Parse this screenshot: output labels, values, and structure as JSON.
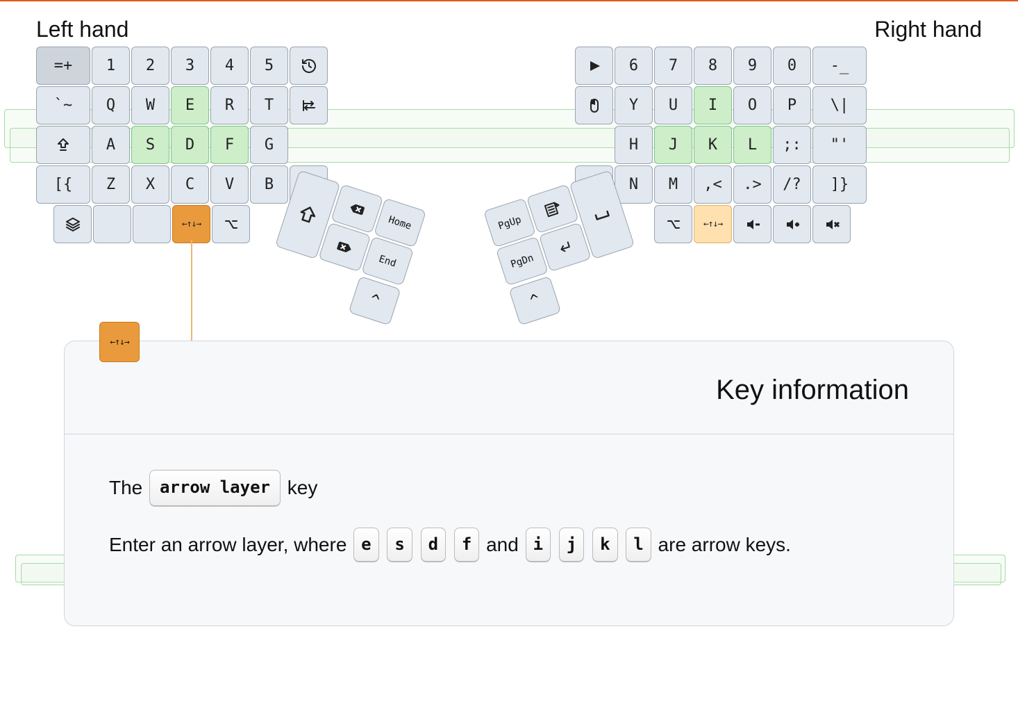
{
  "labels": {
    "left_hand": "Left hand",
    "right_hand": "Right hand"
  },
  "left_rows": [
    [
      {
        "t": "=+",
        "w": "wide",
        "cls": "dim"
      },
      {
        "t": "1"
      },
      {
        "t": "2"
      },
      {
        "t": "3"
      },
      {
        "t": "4"
      },
      {
        "t": "5"
      },
      {
        "icon": "history"
      }
    ],
    [
      {
        "t": "`~",
        "w": "wide"
      },
      {
        "t": "Q"
      },
      {
        "t": "W"
      },
      {
        "t": "E",
        "cls": "green"
      },
      {
        "t": "R"
      },
      {
        "t": "T"
      },
      {
        "icon": "tabright"
      }
    ],
    [
      {
        "icon": "shiftup",
        "w": "wide"
      },
      {
        "t": "A"
      },
      {
        "t": "S",
        "cls": "green"
      },
      {
        "t": "D",
        "cls": "green"
      },
      {
        "t": "F",
        "cls": "green"
      },
      {
        "t": "G"
      }
    ],
    [
      {
        "t": "[{",
        "w": "wide"
      },
      {
        "t": "Z"
      },
      {
        "t": "X"
      },
      {
        "t": "C"
      },
      {
        "t": "V"
      },
      {
        "t": "B"
      },
      {
        "icon": "cmd"
      }
    ],
    [
      {
        "blank": true,
        "w": "wide",
        "invis": true
      },
      {
        "icon": "layers"
      },
      {
        "t": ""
      },
      {
        "t": ""
      },
      {
        "icon": "arrows",
        "cls": "orange"
      },
      {
        "icon": "opt"
      }
    ]
  ],
  "right_rows": [
    [
      {
        "icon": "play"
      },
      {
        "t": "6"
      },
      {
        "t": "7"
      },
      {
        "t": "8"
      },
      {
        "t": "9"
      },
      {
        "t": "0"
      },
      {
        "t": "-_",
        "w": "wide"
      }
    ],
    [
      {
        "icon": "mouse"
      },
      {
        "t": "Y"
      },
      {
        "t": "U"
      },
      {
        "t": "I",
        "cls": "green"
      },
      {
        "t": "O"
      },
      {
        "t": "P"
      },
      {
        "t": "\\|",
        "w": "wide"
      }
    ],
    [
      {
        "blank": true,
        "invis": true
      },
      {
        "t": "H"
      },
      {
        "t": "J",
        "cls": "green"
      },
      {
        "t": "K",
        "cls": "green"
      },
      {
        "t": "L",
        "cls": "green"
      },
      {
        "t": ";:"
      },
      {
        "t": "\"'",
        "w": "wide"
      }
    ],
    [
      {
        "icon": "cmd"
      },
      {
        "t": "N"
      },
      {
        "t": "M"
      },
      {
        "t": ",<"
      },
      {
        "t": ".>"
      },
      {
        "t": "/?"
      },
      {
        "t": "]}",
        "w": "wide"
      }
    ],
    [
      {
        "blank": true,
        "invis": true
      },
      {
        "blank": true,
        "invis": true
      },
      {
        "icon": "opt"
      },
      {
        "icon": "arrows",
        "cls": "lightorange"
      },
      {
        "icon": "volminus"
      },
      {
        "icon": "volplus"
      },
      {
        "icon": "volmute"
      }
    ]
  ],
  "thumb_left": {
    "big_icon": "shiftoutline",
    "small": [
      {
        "icon": "bksp"
      },
      {
        "t": "Home"
      },
      {
        "icon": "del"
      },
      {
        "t": "End"
      }
    ],
    "ctrl_icon": "ctrl"
  },
  "thumb_right": {
    "small": [
      {
        "t": "PgUp"
      },
      {
        "icon": "menu"
      },
      {
        "t": "PgDn"
      },
      {
        "icon": "enter"
      }
    ],
    "big_icon": "space",
    "ctrl_icon": "ctrl"
  },
  "info": {
    "title": "Key information",
    "badge_icon": "arrows",
    "sentence_pre": "The",
    "key_name": "arrow layer",
    "sentence_post": "key",
    "desc_pre": "Enter an arrow layer, where",
    "desc_mid": "and",
    "desc_post": "are arrow keys.",
    "left_cluster": [
      "e",
      "s",
      "d",
      "f"
    ],
    "right_cluster": [
      "i",
      "j",
      "k",
      "l"
    ]
  }
}
